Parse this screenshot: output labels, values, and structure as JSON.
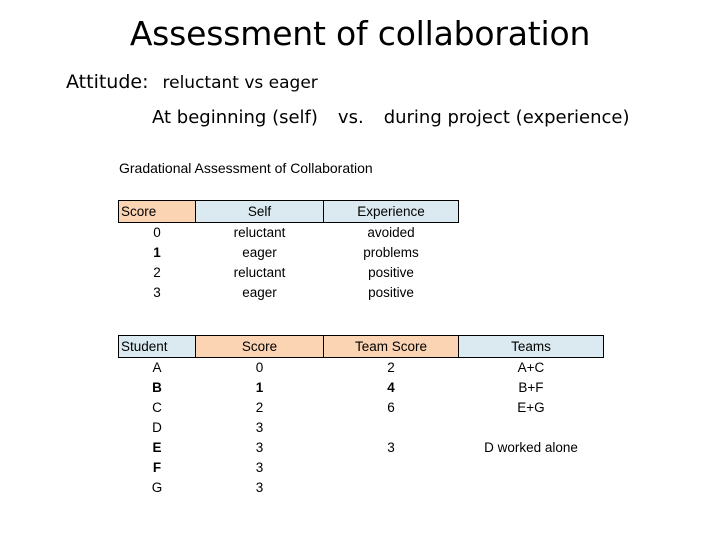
{
  "slide": {
    "title": "Assessment of collaboration",
    "attitude": {
      "label": "Attitude:",
      "value": "reluctant vs  eager"
    },
    "detail": {
      "left": "At beginning (self)",
      "middle": "vs.",
      "right": "during project (experience)"
    }
  },
  "colors": {
    "header_orange": "#FBD4B4",
    "header_blue": "#DBEAF1",
    "border": "#000000",
    "text": "#000000",
    "background": "#FFFFFF"
  },
  "gradational_table": {
    "caption": "Gradational Assessment of Collaboration",
    "headers": [
      "Score",
      "Self",
      "Experience"
    ],
    "header_fills": [
      "orange",
      "blue",
      "blue"
    ],
    "rows": [
      {
        "score": "0",
        "self": "reluctant",
        "experience": "avoided"
      },
      {
        "score": "1",
        "self": "eager",
        "experience": "problems"
      },
      {
        "score": "2",
        "self": "reluctant",
        "experience": "positive"
      },
      {
        "score": "3",
        "self": "eager",
        "experience": "positive"
      }
    ]
  },
  "students_table": {
    "headers": [
      "Student",
      "Score",
      "Team Score",
      "Teams"
    ],
    "header_fills": [
      "blue",
      "orange",
      "orange",
      "blue"
    ],
    "rows": [
      {
        "student": "A",
        "score": "0",
        "team_score": "2",
        "teams": "A+C"
      },
      {
        "student": "B",
        "score": "1",
        "team_score": "4",
        "teams": "B+F"
      },
      {
        "student": "C",
        "score": "2",
        "team_score": "6",
        "teams": "E+G"
      },
      {
        "student": "D",
        "score": "3",
        "team_score": "",
        "teams": ""
      },
      {
        "student": "E",
        "score": "3",
        "team_score": "3",
        "teams": "D worked alone"
      },
      {
        "student": "F",
        "score": "3",
        "team_score": "",
        "teams": ""
      },
      {
        "student": "G",
        "score": "3",
        "team_score": "",
        "teams": ""
      }
    ]
  }
}
